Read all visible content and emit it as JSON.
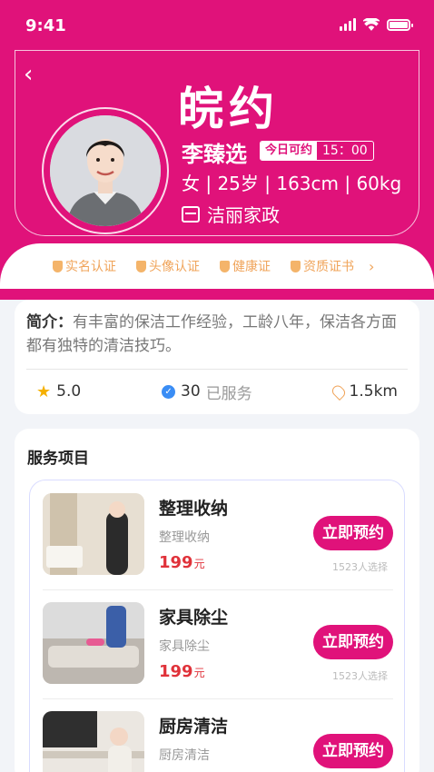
{
  "status_bar": {
    "time": "9:41"
  },
  "header": {
    "logo_text": "皖约"
  },
  "profile": {
    "name": "李臻选",
    "availability_label": "今日可约",
    "availability_time": "15：00",
    "info": "女 | 25岁 | 163cm | 60kg",
    "company": "洁丽家政"
  },
  "certifications": [
    "实名认证",
    "头像认证",
    "健康证",
    "资质证书"
  ],
  "intro": {
    "label": "简介：",
    "text": "有丰富的保洁工作经验，工龄八年，保洁各方面都有独特的清洁技巧。"
  },
  "stats": {
    "rating": "5.0",
    "served_count": "30",
    "served_label": "已服务",
    "distance": "1.5km"
  },
  "services": {
    "title": "服务项目",
    "items": [
      {
        "name": "整理收纳",
        "subtitle": "整理收纳",
        "price": "199",
        "unit": "元",
        "button": "立即预约",
        "count": "1523人选择"
      },
      {
        "name": "家具除尘",
        "subtitle": "家具除尘",
        "price": "199",
        "unit": "元",
        "button": "立即预约",
        "count": "1523人选择"
      },
      {
        "name": "厨房清洁",
        "subtitle": "厨房清洁",
        "price": "",
        "unit": "",
        "button": "立即预约",
        "count": ""
      }
    ]
  },
  "colors": {
    "brand": "#e0127a",
    "price": "#e0323a",
    "cert": "#f0a45a"
  }
}
